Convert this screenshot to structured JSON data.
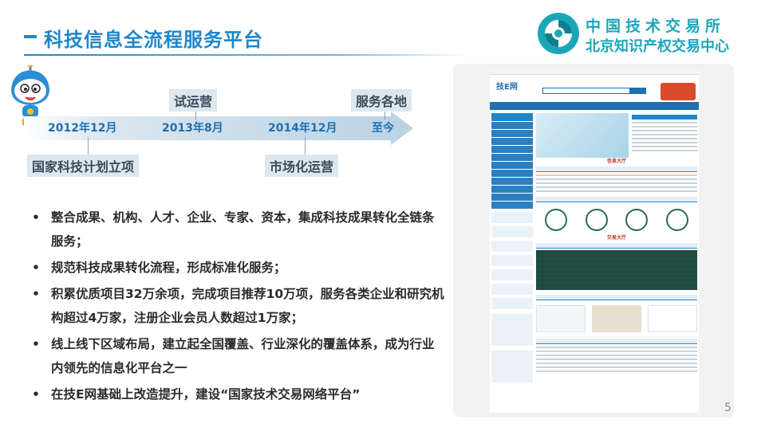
{
  "slide": {
    "title": "科技信息全流程服务平台",
    "page_number": "5"
  },
  "logo": {
    "line1": "中国技术交易所",
    "line2": "北京知识产权交易中心"
  },
  "timeline": {
    "dates": [
      "2012年12月",
      "2013年8月",
      "2014年12月",
      "至今"
    ],
    "milestones": {
      "national_project": "国家科技计划立项",
      "trial_operation": "试运营",
      "market_operation": "市场化运营",
      "service_everywhere": "服务各地"
    }
  },
  "bullets": [
    "整合成果、机构、人才、企业、专家、资本，集成科技成果转化全链条服务；",
    "规范科技成果转化流程，形成标准化服务；",
    "积累优质项目32万余项，完成项目推荐10万项，服务各类企业和研究机构超过4万家，注册企业会员人数超过1万家；",
    "线上线下区域布局，建立起全国覆盖、行业深化的覆盖体系，成为行业内领先的信息化平台之一",
    "在技E网基础上改造提升，建设“国家技术交易网络平台”"
  ],
  "bullet_marker": "•",
  "screenshot": {
    "site_logo": "技E网",
    "section_info": "信息大厅",
    "section_trade": "交易大厅"
  },
  "colors": {
    "title": "#1f86c9",
    "logo": "#1ba6b8",
    "timeline_date": "#1f6fb2"
  }
}
